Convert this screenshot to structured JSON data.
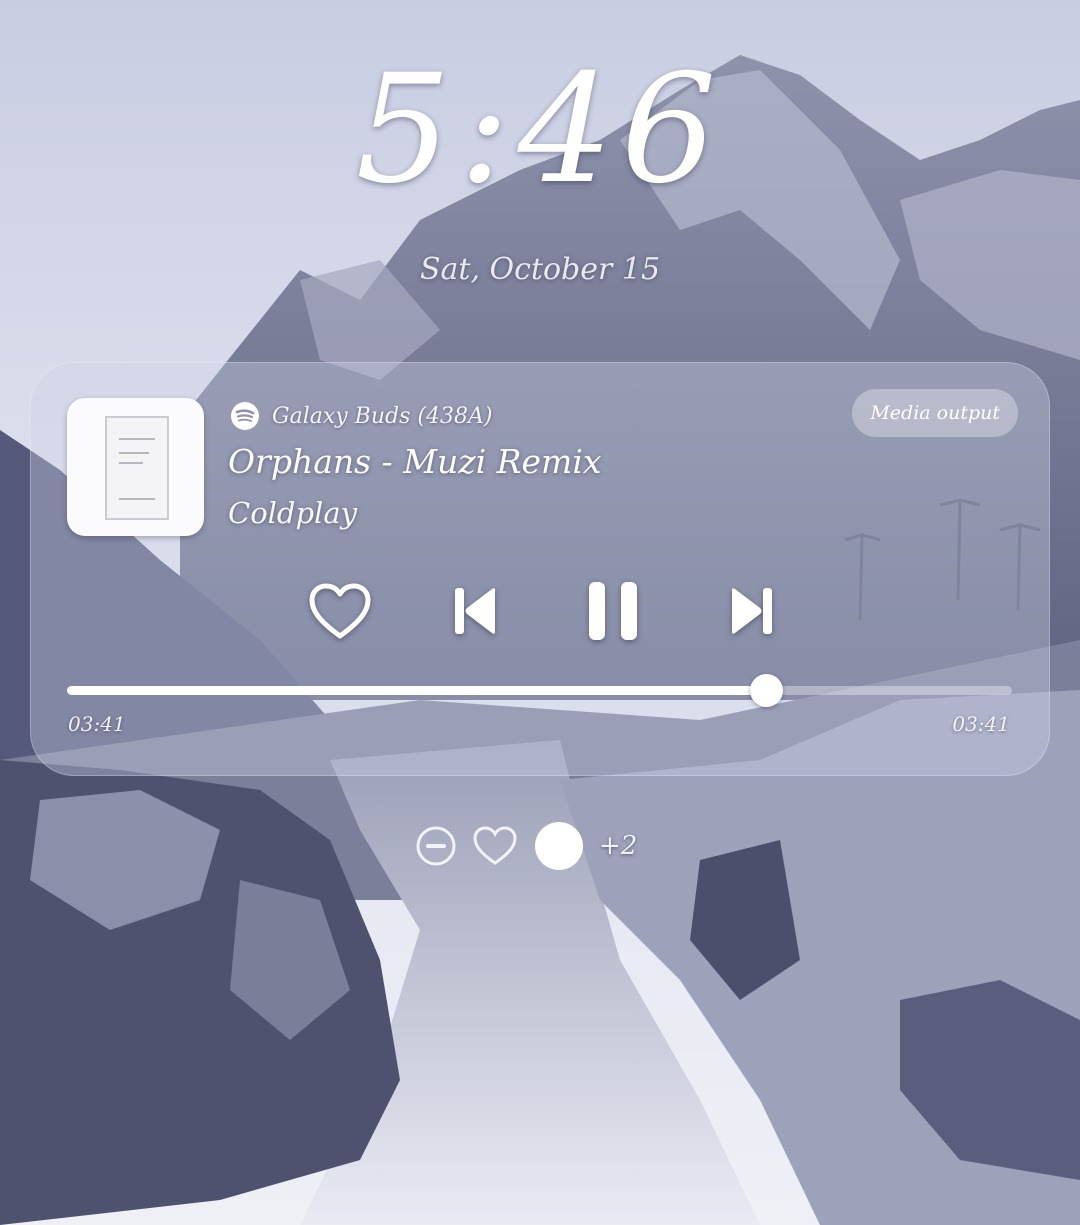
{
  "lockscreen": {
    "time": "5:46",
    "date": "Sat, October 15"
  },
  "media": {
    "output_device": "Galaxy Buds (438A)",
    "output_app_icon": "spotify-icon",
    "media_output_label": "Media output",
    "title": "Orphans - Muzi Remix",
    "artist": "Coldplay",
    "elapsed": "03:41",
    "duration": "03:41",
    "progress_fraction": 0.74,
    "controls": [
      "heart-icon",
      "skip-previous-icon",
      "pause-icon",
      "skip-next-icon"
    ]
  },
  "notifications": {
    "icons": [
      "minus-circle-icon",
      "heart-icon",
      "dot-icon"
    ],
    "more_count": "+2"
  },
  "colors": {
    "sky": "#d7dbea",
    "card_tint": "#cdd2e8",
    "foreground": "#ffffff"
  }
}
